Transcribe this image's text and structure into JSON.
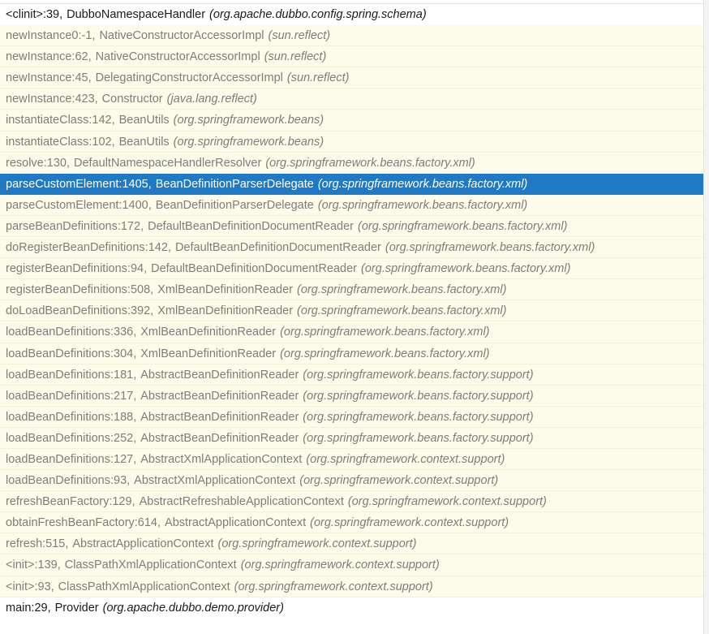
{
  "colors": {
    "selected_bg": "#1f79c4",
    "row_bg": "#fdfbe9",
    "active_text": "#1a1a1a",
    "inactive_text": "#7d7d7d"
  },
  "frames": [
    {
      "method": "<clinit>:39",
      "class": "DubboNamespaceHandler",
      "package": "org.apache.dubbo.config.spring.schema",
      "state": "active"
    },
    {
      "method": "newInstance0:-1",
      "class": "NativeConstructorAccessorImpl",
      "package": "sun.reflect",
      "state": "library"
    },
    {
      "method": "newInstance:62",
      "class": "NativeConstructorAccessorImpl",
      "package": "sun.reflect",
      "state": "library"
    },
    {
      "method": "newInstance:45",
      "class": "DelegatingConstructorAccessorImpl",
      "package": "sun.reflect",
      "state": "library"
    },
    {
      "method": "newInstance:423",
      "class": "Constructor",
      "package": "java.lang.reflect",
      "state": "library"
    },
    {
      "method": "instantiateClass:142",
      "class": "BeanUtils",
      "package": "org.springframework.beans",
      "state": "library"
    },
    {
      "method": "instantiateClass:102",
      "class": "BeanUtils",
      "package": "org.springframework.beans",
      "state": "library"
    },
    {
      "method": "resolve:130",
      "class": "DefaultNamespaceHandlerResolver",
      "package": "org.springframework.beans.factory.xml",
      "state": "library"
    },
    {
      "method": "parseCustomElement:1405",
      "class": "BeanDefinitionParserDelegate",
      "package": "org.springframework.beans.factory.xml",
      "state": "selected"
    },
    {
      "method": "parseCustomElement:1400",
      "class": "BeanDefinitionParserDelegate",
      "package": "org.springframework.beans.factory.xml",
      "state": "library"
    },
    {
      "method": "parseBeanDefinitions:172",
      "class": "DefaultBeanDefinitionDocumentReader",
      "package": "org.springframework.beans.factory.xml",
      "state": "library"
    },
    {
      "method": "doRegisterBeanDefinitions:142",
      "class": "DefaultBeanDefinitionDocumentReader",
      "package": "org.springframework.beans.factory.xml",
      "state": "library"
    },
    {
      "method": "registerBeanDefinitions:94",
      "class": "DefaultBeanDefinitionDocumentReader",
      "package": "org.springframework.beans.factory.xml",
      "state": "library"
    },
    {
      "method": "registerBeanDefinitions:508",
      "class": "XmlBeanDefinitionReader",
      "package": "org.springframework.beans.factory.xml",
      "state": "library"
    },
    {
      "method": "doLoadBeanDefinitions:392",
      "class": "XmlBeanDefinitionReader",
      "package": "org.springframework.beans.factory.xml",
      "state": "library"
    },
    {
      "method": "loadBeanDefinitions:336",
      "class": "XmlBeanDefinitionReader",
      "package": "org.springframework.beans.factory.xml",
      "state": "library"
    },
    {
      "method": "loadBeanDefinitions:304",
      "class": "XmlBeanDefinitionReader",
      "package": "org.springframework.beans.factory.xml",
      "state": "library"
    },
    {
      "method": "loadBeanDefinitions:181",
      "class": "AbstractBeanDefinitionReader",
      "package": "org.springframework.beans.factory.support",
      "state": "library"
    },
    {
      "method": "loadBeanDefinitions:217",
      "class": "AbstractBeanDefinitionReader",
      "package": "org.springframework.beans.factory.support",
      "state": "library"
    },
    {
      "method": "loadBeanDefinitions:188",
      "class": "AbstractBeanDefinitionReader",
      "package": "org.springframework.beans.factory.support",
      "state": "library"
    },
    {
      "method": "loadBeanDefinitions:252",
      "class": "AbstractBeanDefinitionReader",
      "package": "org.springframework.beans.factory.support",
      "state": "library"
    },
    {
      "method": "loadBeanDefinitions:127",
      "class": "AbstractXmlApplicationContext",
      "package": "org.springframework.context.support",
      "state": "library"
    },
    {
      "method": "loadBeanDefinitions:93",
      "class": "AbstractXmlApplicationContext",
      "package": "org.springframework.context.support",
      "state": "library"
    },
    {
      "method": "refreshBeanFactory:129",
      "class": "AbstractRefreshableApplicationContext",
      "package": "org.springframework.context.support",
      "state": "library"
    },
    {
      "method": "obtainFreshBeanFactory:614",
      "class": "AbstractApplicationContext",
      "package": "org.springframework.context.support",
      "state": "library"
    },
    {
      "method": "refresh:515",
      "class": "AbstractApplicationContext",
      "package": "org.springframework.context.support",
      "state": "library"
    },
    {
      "method": "<init>:139",
      "class": "ClassPathXmlApplicationContext",
      "package": "org.springframework.context.support",
      "state": "library"
    },
    {
      "method": "<init>:93",
      "class": "ClassPathXmlApplicationContext",
      "package": "org.springframework.context.support",
      "state": "library"
    },
    {
      "method": "main:29",
      "class": "Provider",
      "package": "org.apache.dubbo.demo.provider",
      "state": "active"
    }
  ]
}
